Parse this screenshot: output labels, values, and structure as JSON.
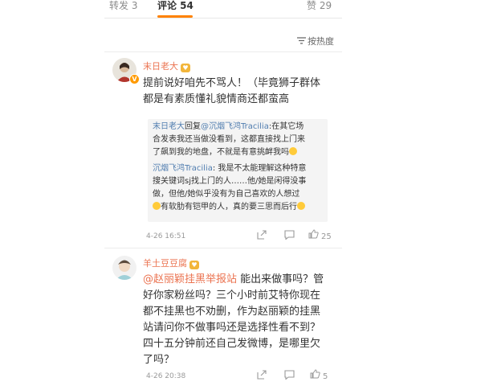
{
  "tabs": {
    "repost": "转发 3",
    "comments": "评论 54",
    "likes": "赞 29"
  },
  "sort_label": "按热度",
  "comments": [
    {
      "user": "末日老大",
      "lines": [
        "提前说好咱先不骂人！（毕竟狮子群体",
        "都是有素质懂礼貌情商还都蛮高"
      ],
      "replies": {
        "r1_name": "末日老大",
        "r1_verb": "回复",
        "r1_mention": "@沉烟飞鸿Tracilia",
        "r1_text1": ":在其它场",
        "r1_text2": "合发表我还当做没看到，这都直接找上门来",
        "r1_text3": "了飙到我的地盘，不就是有意挑衅我吗",
        "r2_name": "沉烟飞鸿Tracilia",
        "r2_text1": ": 我是不太能理解这种特意",
        "r2_text2": "搜关键词sj找上门的人……他/她是闲得没事",
        "r2_text3": "做，但他/她似乎没有为自己喜欢的人想过",
        "r2_text4": "有软肋有铠甲的人，真的要三思而后行"
      },
      "time": "4-26 16:51",
      "like_count": "25"
    },
    {
      "user": "羊土豆豆腐",
      "mention": "@赵丽颖挂黑举报站",
      "line1_rest": " 能出来做事吗？管",
      "lines": [
        "好你家粉丝吗？三个小时前艾特你现在",
        "都不挂黑也不劝删，作为赵丽颖的挂黑",
        "站请问你不做事吗还是选择性看不到？",
        "四十五分钟前还自己发微博，是哪里欠",
        "了吗？"
      ],
      "time": "4-26 20:38",
      "like_count": "5"
    }
  ],
  "icons": [
    "sort-icon",
    "share-icon",
    "comment-icon",
    "like-icon"
  ]
}
